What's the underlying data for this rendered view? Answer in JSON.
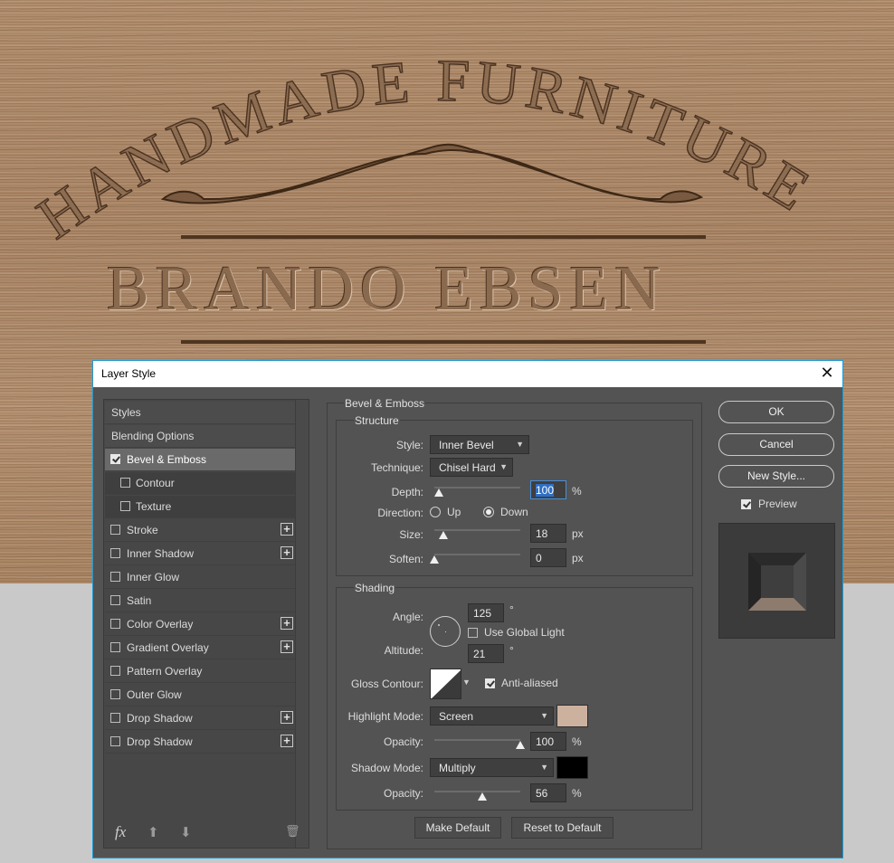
{
  "artwork": {
    "arc_title": "HANDMADE FURNITURE",
    "brand": "BRANDO EBSEN"
  },
  "dialog": {
    "title": "Layer Style",
    "close_glyph": "✕"
  },
  "left_panel": {
    "items": [
      {
        "label": "Styles",
        "checkbox": false,
        "checked": false,
        "plus": false
      },
      {
        "label": "Blending Options",
        "checkbox": false,
        "checked": false,
        "plus": false
      },
      {
        "label": "Bevel & Emboss",
        "checkbox": true,
        "checked": true,
        "plus": false,
        "selected": true
      },
      {
        "label": "Contour",
        "checkbox": true,
        "checked": false,
        "plus": false,
        "sub": true
      },
      {
        "label": "Texture",
        "checkbox": true,
        "checked": false,
        "plus": false,
        "sub": true
      },
      {
        "label": "Stroke",
        "checkbox": true,
        "checked": false,
        "plus": true
      },
      {
        "label": "Inner Shadow",
        "checkbox": true,
        "checked": false,
        "plus": true
      },
      {
        "label": "Inner Glow",
        "checkbox": true,
        "checked": false,
        "plus": false
      },
      {
        "label": "Satin",
        "checkbox": true,
        "checked": false,
        "plus": false
      },
      {
        "label": "Color Overlay",
        "checkbox": true,
        "checked": false,
        "plus": true
      },
      {
        "label": "Gradient Overlay",
        "checkbox": true,
        "checked": false,
        "plus": true
      },
      {
        "label": "Pattern Overlay",
        "checkbox": true,
        "checked": false,
        "plus": false
      },
      {
        "label": "Outer Glow",
        "checkbox": true,
        "checked": false,
        "plus": false
      },
      {
        "label": "Drop Shadow",
        "checkbox": true,
        "checked": false,
        "plus": true
      },
      {
        "label": "Drop Shadow",
        "checkbox": true,
        "checked": false,
        "plus": true
      }
    ],
    "plus_glyph": "+",
    "fx_label": "fx",
    "up_glyph": "⬆",
    "down_glyph": "⬇",
    "trash_glyph": "🗑"
  },
  "bevel": {
    "section_title": "Bevel & Emboss",
    "structure": {
      "title": "Structure",
      "style_label": "Style:",
      "style_value": "Inner Bevel",
      "technique_label": "Technique:",
      "technique_value": "Chisel Hard",
      "depth_label": "Depth:",
      "depth_value": "100",
      "depth_unit": "%",
      "depth_slider_fraction": 0.05,
      "direction_label": "Direction:",
      "direction_up": "Up",
      "direction_down": "Down",
      "direction_selected": "Down",
      "size_label": "Size:",
      "size_value": "18",
      "size_unit": "px",
      "size_slider_fraction": 0.1,
      "soften_label": "Soften:",
      "soften_value": "0",
      "soften_unit": "px",
      "soften_slider_fraction": 0.0
    },
    "shading": {
      "title": "Shading",
      "angle_label": "Angle:",
      "angle_value": "125",
      "angle_unit": "°",
      "use_global_light": "Use Global Light",
      "use_global_light_checked": false,
      "altitude_label": "Altitude:",
      "altitude_value": "21",
      "altitude_unit": "°",
      "gloss_contour_label": "Gloss Contour:",
      "anti_aliased": "Anti-aliased",
      "anti_aliased_checked": true,
      "highlight_mode_label": "Highlight Mode:",
      "highlight_mode_value": "Screen",
      "highlight_color": "#cdb19f",
      "highlight_opacity_label": "Opacity:",
      "highlight_opacity_value": "100",
      "highlight_opacity_unit": "%",
      "highlight_opacity_fraction": 1.0,
      "shadow_mode_label": "Shadow Mode:",
      "shadow_mode_value": "Multiply",
      "shadow_color": "#000000",
      "shadow_opacity_label": "Opacity:",
      "shadow_opacity_value": "56",
      "shadow_opacity_unit": "%",
      "shadow_opacity_fraction": 0.56
    },
    "make_default": "Make Default",
    "reset_default": "Reset to Default"
  },
  "right": {
    "ok": "OK",
    "cancel": "Cancel",
    "new_style": "New Style...",
    "preview_label": "Preview",
    "preview_checked": true
  },
  "colors": {
    "dialog_bg": "#535353",
    "accent_border": "#1c9bd6",
    "focus": "#2f6fc4"
  }
}
